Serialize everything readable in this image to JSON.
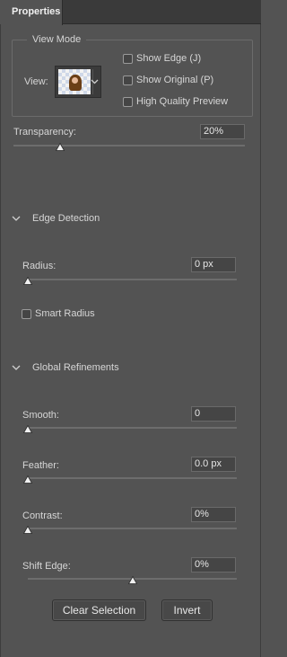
{
  "panel": {
    "tab_label": "Properties"
  },
  "view_mode": {
    "title": "View Mode",
    "view_label": "View:",
    "show_edge_label": "Show Edge (J)",
    "show_original_label": "Show Original (P)",
    "high_quality_label": "High Quality Preview",
    "show_edge_checked": false,
    "show_original_checked": false,
    "high_quality_checked": false
  },
  "transparency": {
    "label": "Transparency:",
    "value": "20%",
    "level": 0.2
  },
  "edge_detection": {
    "title": "Edge Detection",
    "radius_label": "Radius:",
    "radius_value": "0 px",
    "radius_level": 0,
    "smart_radius_label": "Smart Radius",
    "smart_radius_checked": false
  },
  "global_refinements": {
    "title": "Global Refinements",
    "smooth_label": "Smooth:",
    "smooth_value": "0",
    "smooth_level": 0,
    "feather_label": "Feather:",
    "feather_value": "0.0 px",
    "feather_level": 0,
    "contrast_label": "Contrast:",
    "contrast_value": "0%",
    "contrast_level": 0,
    "shift_edge_label": "Shift Edge:",
    "shift_edge_value": "0%",
    "shift_edge_level": 0.5
  },
  "actions": {
    "clear_selection_label": "Clear Selection",
    "invert_label": "Invert"
  },
  "colors": {
    "panel_bg": "#535353",
    "tab_bar_bg": "#3a3a3a",
    "handle_fill": "#f0f0f0"
  }
}
